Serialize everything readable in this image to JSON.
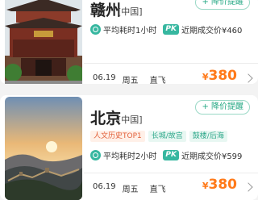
{
  "cards": [
    {
      "city": "赣州",
      "country": "[中国]",
      "reminder": "+ 降价提醒",
      "avg_flight": "平均耗时1小时",
      "pk_label": "PK",
      "recent_deal": "近期成交价¥460",
      "date": "06.19",
      "weekday": "周五",
      "flight_type": "直飞",
      "currency": "¥",
      "price": "380"
    },
    {
      "city": "北京",
      "country": "[中国]",
      "reminder": "+ 降价提醒",
      "tags": [
        "人文历史TOP1",
        "长城/故宫",
        "鼓楼/后海"
      ],
      "avg_flight": "平均耗时2小时",
      "pk_label": "PK",
      "recent_deal": "近期成交价¥599",
      "date": "06.19",
      "weekday": "周五",
      "flight_type": "直飞",
      "currency": "¥",
      "price": "380"
    }
  ],
  "colors": {
    "accent_green": "#37b7a0",
    "price_orange": "#ff7a1a",
    "tag_orange": "#e2603a"
  }
}
